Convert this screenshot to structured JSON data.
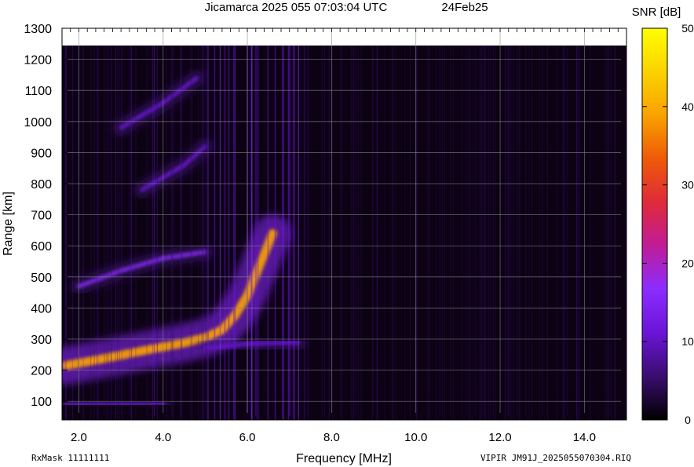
{
  "chart_data": {
    "type": "heatmap",
    "title": "Jicamarca 2025 055 07:03:04 UTC",
    "date_label": "24Feb25",
    "xlabel": "Frequency [MHz]",
    "ylabel": "Range [km]",
    "xlim": [
      1.6,
      15.0
    ],
    "ylim": [
      40,
      1300
    ],
    "x_ticks": [
      2.0,
      4.0,
      6.0,
      8.0,
      10.0,
      12.0,
      14.0
    ],
    "x_tick_labels": [
      "2.0",
      "4.0",
      "6.0",
      "8.0",
      "10.0",
      "12.0",
      "14.0"
    ],
    "y_ticks": [
      100,
      200,
      300,
      400,
      500,
      600,
      700,
      800,
      900,
      1000,
      1100,
      1200,
      1300
    ],
    "y_tick_labels": [
      "100",
      "200",
      "300",
      "400",
      "500",
      "600",
      "700",
      "800",
      "900",
      "1000",
      "1100",
      "1200",
      "1300"
    ],
    "grid": true,
    "colorbar": {
      "label": "SNR [dB]",
      "range": [
        0,
        50
      ],
      "ticks": [
        0,
        10,
        20,
        30,
        40,
        50
      ],
      "tick_labels": [
        "0",
        "10",
        "20",
        "30",
        "40",
        "50"
      ],
      "colors": [
        "#000000",
        "#3a0d6e",
        "#6a14d8",
        "#8b2cff",
        "#c01c98",
        "#e02a3a",
        "#ee5a08",
        "#f9a200",
        "#fbd200",
        "#ffff00"
      ]
    },
    "features": [
      {
        "name": "F-layer ordinary trace",
        "points": [
          [
            1.7,
            215
          ],
          [
            2.5,
            235
          ],
          [
            3.5,
            262
          ],
          [
            4.5,
            288
          ],
          [
            5.0,
            305
          ],
          [
            5.4,
            330
          ],
          [
            5.7,
            375
          ],
          [
            6.0,
            440
          ],
          [
            6.3,
            540
          ],
          [
            6.6,
            640
          ]
        ],
        "snr_db": 38
      },
      {
        "name": "second multiple",
        "points": [
          [
            2.0,
            470
          ],
          [
            3.0,
            520
          ],
          [
            4.0,
            560
          ],
          [
            5.0,
            580
          ]
        ],
        "snr_db": 14
      },
      {
        "name": "oblique trace",
        "points": [
          [
            3.5,
            780
          ],
          [
            4.5,
            860
          ],
          [
            5.0,
            920
          ]
        ],
        "snr_db": 10
      },
      {
        "name": "upper trace",
        "points": [
          [
            3.0,
            980
          ],
          [
            4.0,
            1060
          ],
          [
            4.8,
            1140
          ]
        ],
        "snr_db": 9
      },
      {
        "name": "lower edge",
        "points": [
          [
            5.0,
            270
          ],
          [
            6.0,
            285
          ],
          [
            7.2,
            290
          ]
        ],
        "snr_db": 12
      },
      {
        "name": "low range trace",
        "points": [
          [
            1.7,
            90
          ],
          [
            4.0,
            95
          ]
        ],
        "snr_db": 9
      }
    ]
  },
  "footer": {
    "left": "RxMask 11111111",
    "right": "VIPIR  JM91J_2025055070304.RIQ"
  }
}
